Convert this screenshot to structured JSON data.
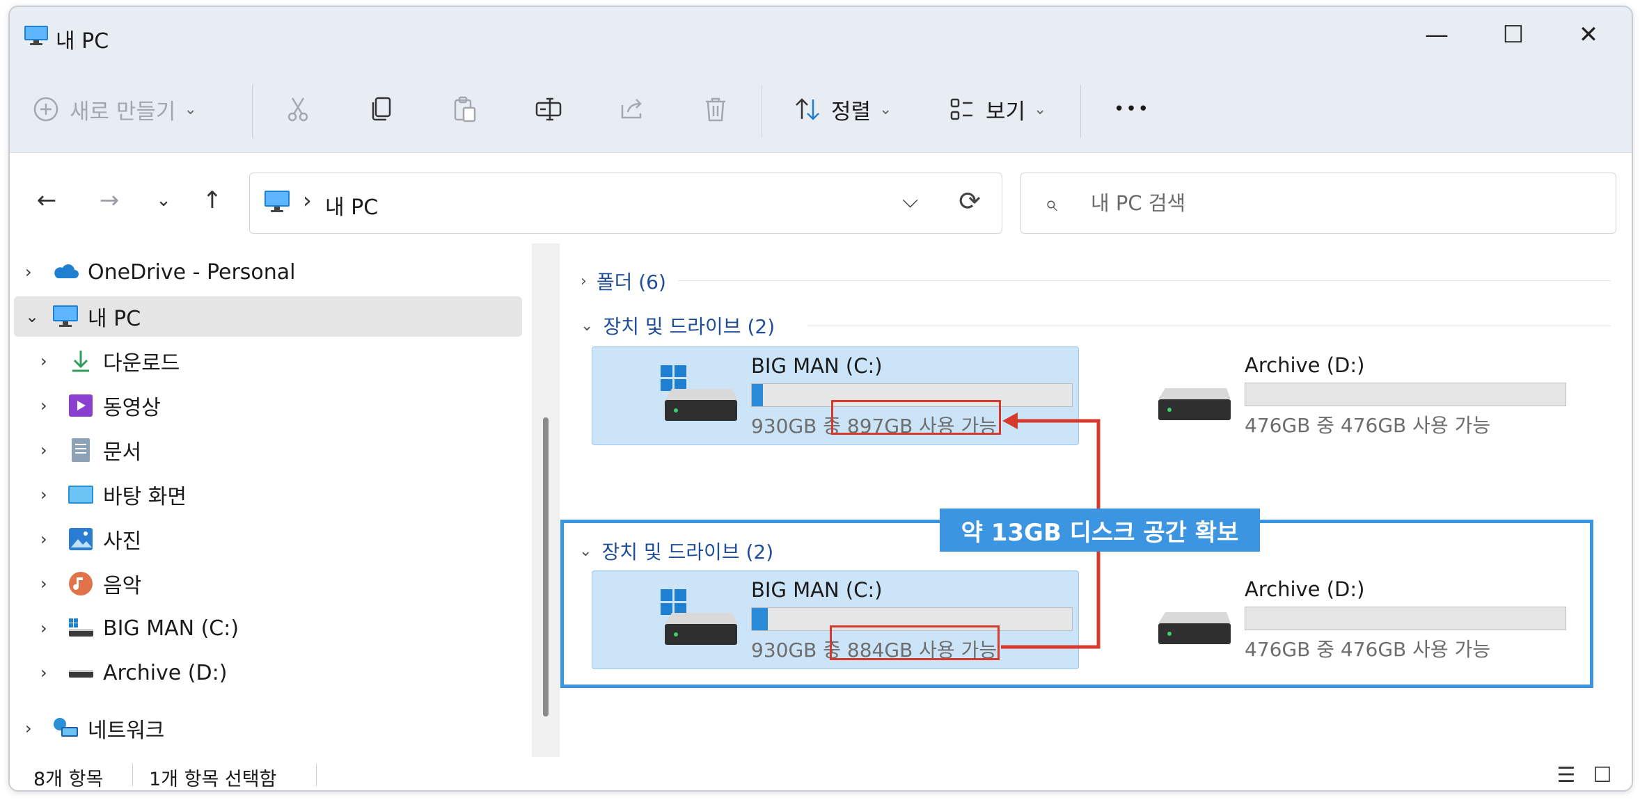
{
  "window": {
    "title": "내 PC",
    "controls": {
      "minimize": "—",
      "maximize": "☐",
      "close": "✕"
    }
  },
  "toolbar": {
    "new_label": "새로 만들기",
    "sort_label": "정렬",
    "view_label": "보기",
    "more_label": "•••",
    "icons": [
      "plus-circle-icon",
      "cut-icon",
      "copy-icon",
      "paste-icon",
      "rename-icon",
      "share-icon",
      "delete-icon",
      "sort-icon",
      "view-icon"
    ]
  },
  "navigation": {
    "back": "←",
    "forward": "→",
    "recent": "⌄",
    "up": "↑",
    "address_separator": "›",
    "address_path": "내 PC",
    "address_dropdown": "⌵",
    "refresh": "⟳",
    "search_placeholder": "내 PC 검색",
    "search_icon": "⌕"
  },
  "sidebar": {
    "items": [
      {
        "label": "OneDrive - Personal",
        "icon": "cloud-icon",
        "expander": "›"
      },
      {
        "label": "내 PC",
        "icon": "pc-icon",
        "expander": "⌄"
      },
      {
        "label": "다운로드",
        "icon": "download-icon",
        "expander": "›"
      },
      {
        "label": "동영상",
        "icon": "video-icon",
        "expander": "›"
      },
      {
        "label": "문서",
        "icon": "document-icon",
        "expander": "›"
      },
      {
        "label": "바탕 화면",
        "icon": "desktop-icon",
        "expander": "›"
      },
      {
        "label": "사진",
        "icon": "picture-icon",
        "expander": "›"
      },
      {
        "label": "음악",
        "icon": "music-icon",
        "expander": "›"
      },
      {
        "label": "BIG MAN (C:)",
        "icon": "system-drive-icon",
        "expander": "›"
      },
      {
        "label": "Archive (D:)",
        "icon": "drive-icon",
        "expander": "›"
      },
      {
        "label": "네트워크",
        "icon": "network-icon",
        "expander": "›"
      }
    ]
  },
  "content": {
    "folders_group": {
      "label": "폴더 (6)",
      "chevron": "›"
    },
    "devices_group": {
      "label": "장치 및 드라이브 (2)",
      "chevron": "⌄"
    },
    "before": {
      "drives": [
        {
          "name": "BIG MAN (C:)",
          "total": "930GB 중",
          "free": "897GB 사용 가능",
          "used_fraction": 0.035
        },
        {
          "name": "Archive (D:)",
          "space": "476GB 중 476GB 사용 가능",
          "used_fraction": 0.0
        }
      ]
    },
    "after": {
      "group_label": "장치 및 드라이브 (2)",
      "drives": [
        {
          "name": "BIG MAN (C:)",
          "total": "930GB 중",
          "free": "884GB 사용 가능",
          "used_fraction": 0.049
        },
        {
          "name": "Archive (D:)",
          "space": "476GB 중 476GB 사용 가능",
          "used_fraction": 0.0
        }
      ]
    }
  },
  "annotation": {
    "callout": "약 13GB 디스크 공간 확보",
    "highlight_color": "#d63a2c",
    "callout_color": "#3b95e0"
  },
  "statusbar": {
    "item_count": "8개 항목",
    "selected": "1개 항목 선택함",
    "details_view": "☰",
    "tiles_view": "☐"
  }
}
